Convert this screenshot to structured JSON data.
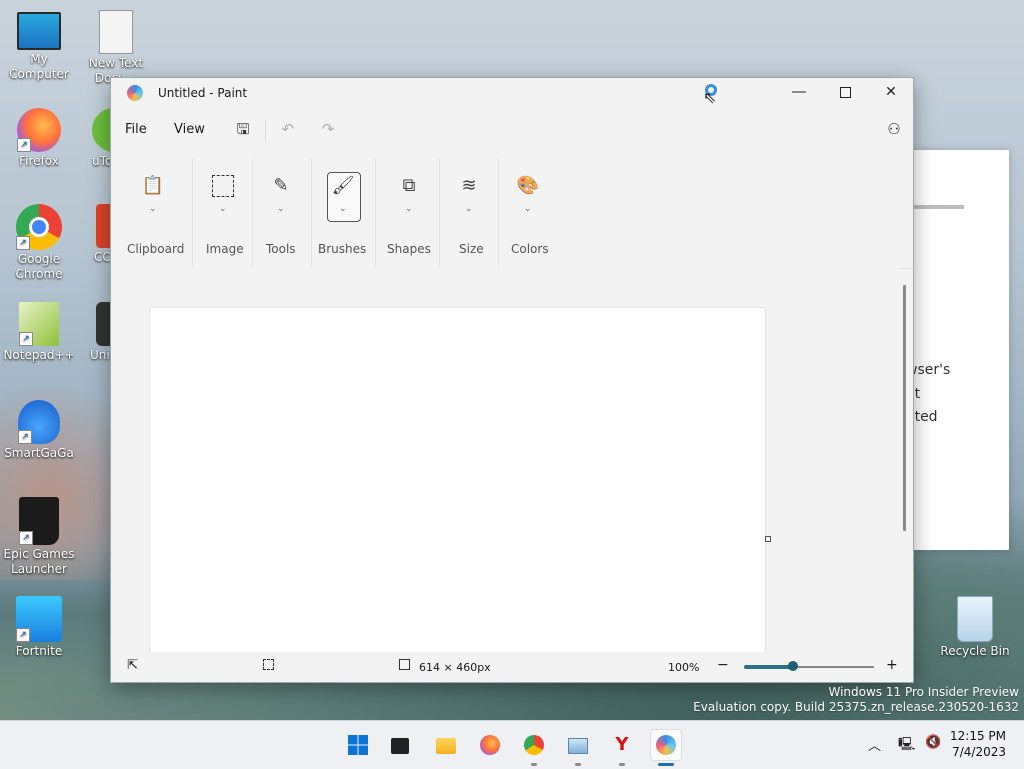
{
  "desktop": {
    "icons": [
      {
        "label": "My Computer"
      },
      {
        "label": "New Text Docu..."
      },
      {
        "label": "Firefox"
      },
      {
        "label": "uTorr..."
      },
      {
        "label": "Google Chrome"
      },
      {
        "label": "CC..."
      },
      {
        "label": "Notepad++"
      },
      {
        "label": "Uni..."
      },
      {
        "label": "SmartGaGa"
      },
      {
        "label": "Epic Games Launcher"
      },
      {
        "label": "Fortnite"
      },
      {
        "label": "Recycle Bin"
      }
    ],
    "bg_window_text": [
      "wser's",
      "et",
      "ated"
    ],
    "watermark_line1": "Windows 11 Pro Insider Preview",
    "watermark_line2": "Evaluation copy. Build 25375.zn_release.230520-1632"
  },
  "paint": {
    "title": "Untitled - Paint",
    "menu": {
      "file": "File",
      "view": "View"
    },
    "ribbon": {
      "groups": [
        {
          "label": "Clipboard",
          "icon": "clipboard-icon"
        },
        {
          "label": "Image",
          "icon": "selection-icon"
        },
        {
          "label": "Tools",
          "icon": "tools-icon"
        },
        {
          "label": "Brushes",
          "icon": "brush-icon"
        },
        {
          "label": "Shapes",
          "icon": "shapes-icon"
        },
        {
          "label": "Size",
          "icon": "size-icon"
        },
        {
          "label": "Colors",
          "icon": "palette-icon"
        }
      ]
    },
    "status": {
      "canvas_size": "614 × 460px",
      "zoom": "100%",
      "zoom_level": 0.38
    }
  },
  "taskbar": {
    "apps": [
      "start-icon",
      "file-manager-icon",
      "file-explorer-icon",
      "firefox-icon",
      "chrome-icon",
      "task-manager-icon",
      "app-y-icon",
      "paint-icon"
    ],
    "clock": {
      "time": "12:15 PM",
      "date": "7/4/2023"
    }
  }
}
